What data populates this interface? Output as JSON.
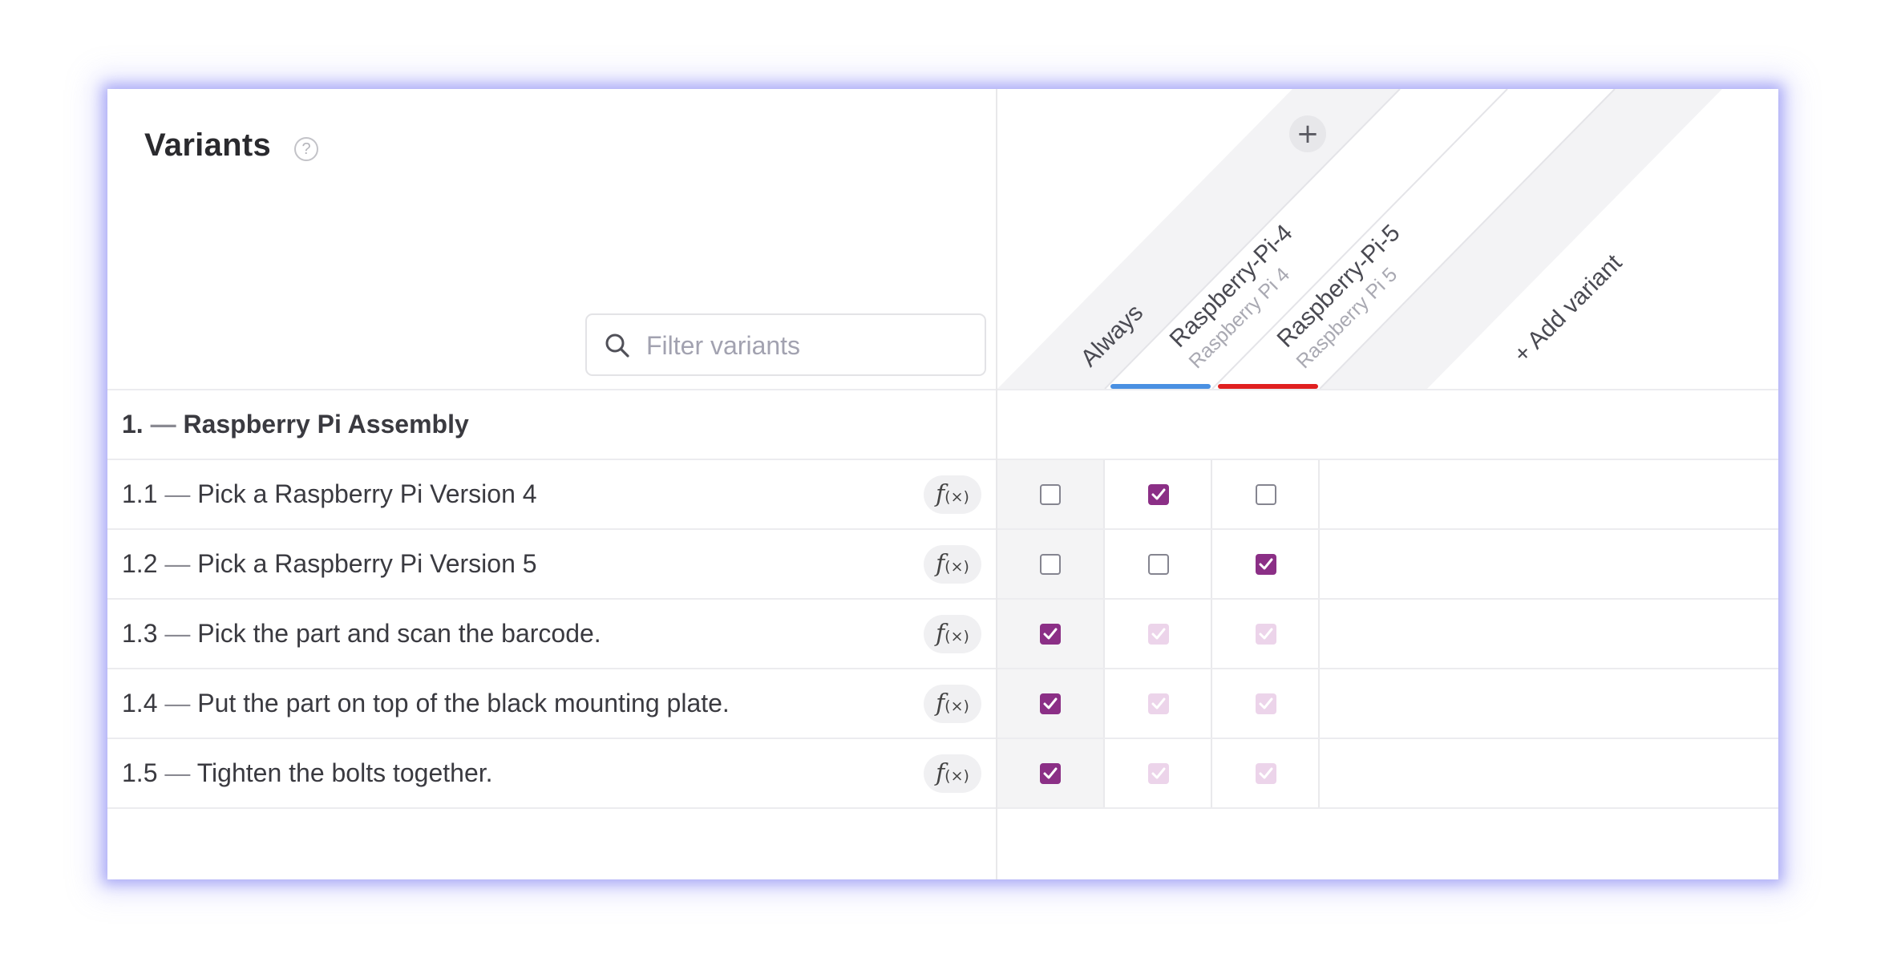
{
  "panel": {
    "title": "Variants",
    "help_glyph": "?"
  },
  "filter": {
    "placeholder": "Filter variants"
  },
  "columns": {
    "add_button_glyph": "+",
    "items": [
      {
        "label": "Always",
        "sublabel": "",
        "underline_color": ""
      },
      {
        "label": "Raspberry-Pi-4",
        "sublabel": "Raspberry Pi 4",
        "underline_color": "#4a90e2"
      },
      {
        "label": "Raspberry-Pi-5",
        "sublabel": "Raspberry Pi 5",
        "underline_color": "#e02020"
      }
    ],
    "add_variant_label": "+ Add variant"
  },
  "group": {
    "number": "1.",
    "dash": "—",
    "title": "Raspberry Pi Assembly"
  },
  "rows": [
    {
      "number": "1.1",
      "dash": "—",
      "text": "Pick a Raspberry Pi Version 4",
      "fx": "f",
      "fx_sub": "(×)",
      "checks": [
        "unchecked",
        "checked",
        "unchecked"
      ]
    },
    {
      "number": "1.2",
      "dash": "—",
      "text": "Pick a Raspberry Pi Version 5",
      "fx": "f",
      "fx_sub": "(×)",
      "checks": [
        "unchecked",
        "unchecked",
        "checked"
      ]
    },
    {
      "number": "1.3",
      "dash": "—",
      "text": "Pick the part and scan the barcode.",
      "fx": "f",
      "fx_sub": "(×)",
      "checks": [
        "checked",
        "faded",
        "faded"
      ]
    },
    {
      "number": "1.4",
      "dash": "—",
      "text": "Put the part on top of the black mounting plate.",
      "fx": "f",
      "fx_sub": "(×)",
      "checks": [
        "checked",
        "faded",
        "faded"
      ]
    },
    {
      "number": "1.5",
      "dash": "—",
      "text": "Tighten the bolts together.",
      "fx": "f",
      "fx_sub": "(×)",
      "checks": [
        "checked",
        "faded",
        "faded"
      ]
    }
  ],
  "colors": {
    "accent_checked": "#8b2f86",
    "faded_checked": "#ecd4ea",
    "glow": "#7878f0"
  }
}
